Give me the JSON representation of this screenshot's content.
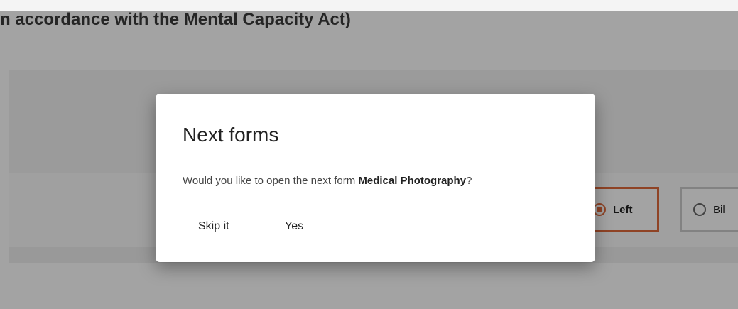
{
  "background": {
    "header_title": "n accordance with the Mental Capacity Act)",
    "radio_options": [
      {
        "label": "Left",
        "selected": true
      },
      {
        "label": "Bil",
        "selected": false
      }
    ]
  },
  "dialog": {
    "title": "Next forms",
    "message_prefix": "Would you like to open the next form ",
    "form_name": "Medical Photography",
    "message_suffix": "?",
    "buttons": {
      "skip": "Skip it",
      "yes": "Yes"
    }
  },
  "colors": {
    "accent": "#e06a3a",
    "overlay": "rgba(0,0,0,0.36)"
  }
}
